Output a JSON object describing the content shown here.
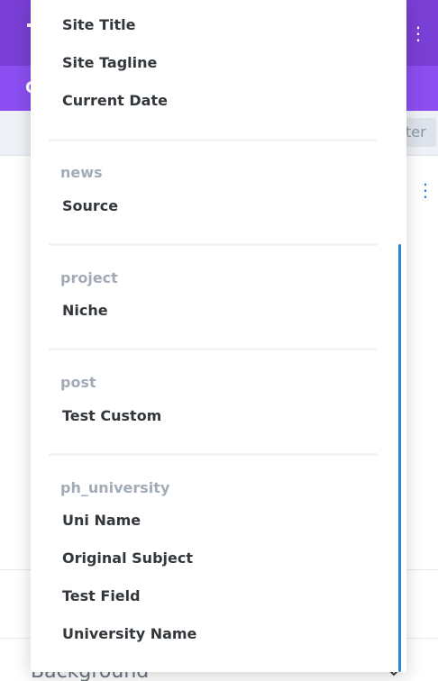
{
  "background": {
    "header_title_fragment": "T",
    "tab_fragment": "C",
    "filter_button_fragment": "ter",
    "section_label": "Background",
    "colors": {
      "header": "#7a3fd4",
      "tabs": "#8b4ef0",
      "accent": "#2b87da"
    }
  },
  "dropdown": {
    "default_items": [
      "Site Title",
      "Site Tagline",
      "Current Date"
    ],
    "groups": [
      {
        "label": "news",
        "items": [
          "Source"
        ]
      },
      {
        "label": "project",
        "items": [
          "Niche"
        ]
      },
      {
        "label": "post",
        "items": [
          "Test Custom"
        ]
      },
      {
        "label": "ph_university",
        "items": [
          "Uni Name",
          "Original Subject",
          "Test Field",
          "University Name"
        ]
      }
    ]
  }
}
